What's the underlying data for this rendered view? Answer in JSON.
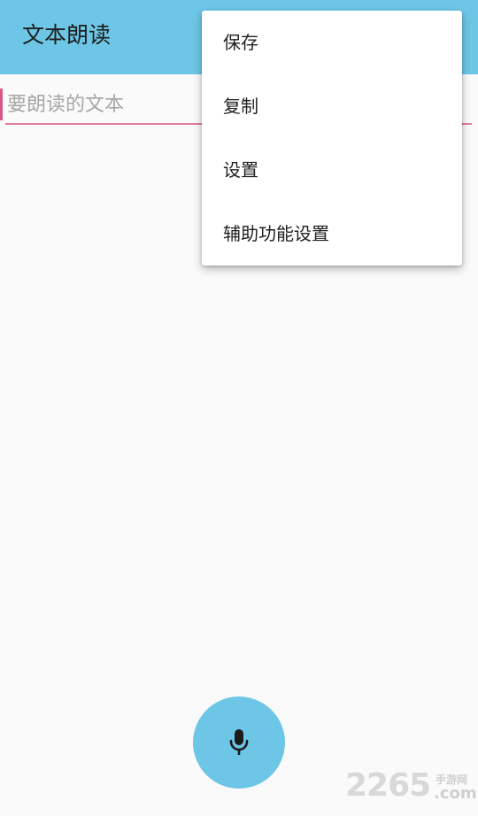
{
  "app": {
    "title": "文本朗读"
  },
  "editor": {
    "placeholder": "要朗读的文本",
    "value": ""
  },
  "overflow_menu": {
    "items": [
      {
        "label": "保存"
      },
      {
        "label": "复制"
      },
      {
        "label": "设置"
      },
      {
        "label": "辅助功能设置"
      }
    ]
  },
  "fab": {
    "icon": "microphone-icon"
  },
  "watermark": {
    "digits": "2265",
    "cn": "手游网",
    "com": ".com"
  },
  "colors": {
    "appbar": "#6ec6e6",
    "accent": "#e07aa0",
    "background": "#fafafa"
  }
}
